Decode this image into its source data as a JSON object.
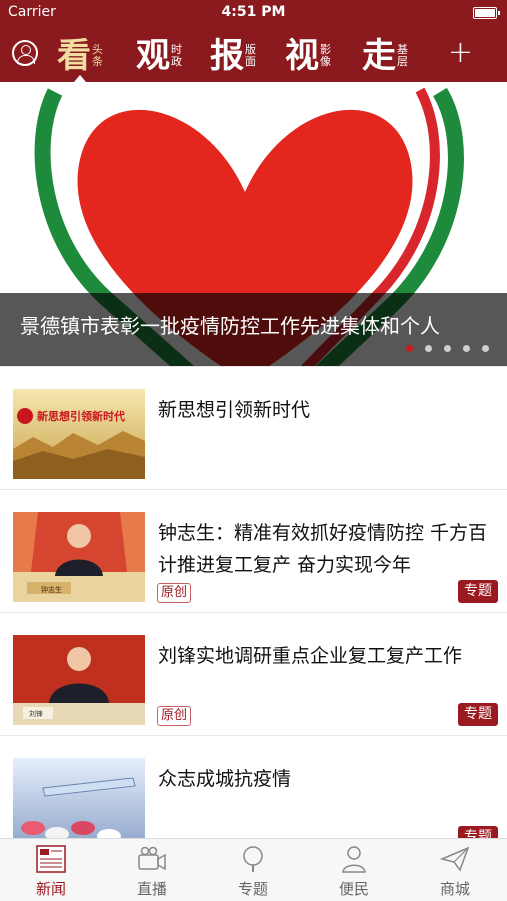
{
  "status_bar": {
    "carrier": "Carrier",
    "time": "4:51 PM"
  },
  "nav": {
    "categories": [
      {
        "big": "看",
        "small": "头条",
        "active": true
      },
      {
        "big": "观",
        "small": "时政",
        "active": false
      },
      {
        "big": "报",
        "small": "版面",
        "active": false
      },
      {
        "big": "视",
        "small": "影像",
        "active": false
      },
      {
        "big": "走",
        "small": "基层",
        "active": false
      }
    ],
    "plus": "+"
  },
  "banner": {
    "caption": "景德镇市表彰一批疫情防控工作先进集体和个人",
    "dots": 5,
    "active_dot": 0,
    "colors": {
      "heart": "#e3271f",
      "ring_green": "#1e8a3c",
      "ring_red": "#d8262d"
    }
  },
  "news": [
    {
      "title": "新思想引领新时代",
      "thumb_text": "新思想引领新时代",
      "tag": "",
      "topic": ""
    },
    {
      "title": "钟志生：精准有效抓好疫情防控 千方百计推进复工复产 奋力实现今年",
      "thumb_text": "钟志生",
      "tag": "原创",
      "topic": "专题"
    },
    {
      "title": "刘锋实地调研重点企业复工复产工作",
      "thumb_text": "刘锋",
      "tag": "原创",
      "topic": "专题"
    },
    {
      "title": "众志成城抗疫情",
      "thumb_text": "",
      "tag": "",
      "topic": "专题"
    }
  ],
  "tabbar": {
    "tabs": [
      {
        "label": "新闻",
        "icon": "newspaper-icon",
        "active": true
      },
      {
        "label": "直播",
        "icon": "video-camera-icon",
        "active": false
      },
      {
        "label": "专题",
        "icon": "magnifier-icon",
        "active": false
      },
      {
        "label": "便民",
        "icon": "person-icon",
        "active": false
      },
      {
        "label": "商城",
        "icon": "paper-plane-icon",
        "active": false
      }
    ]
  },
  "colors": {
    "brand": "#8b1a1f",
    "accent": "#9b1a20",
    "active_tab": "#9b1a20"
  }
}
